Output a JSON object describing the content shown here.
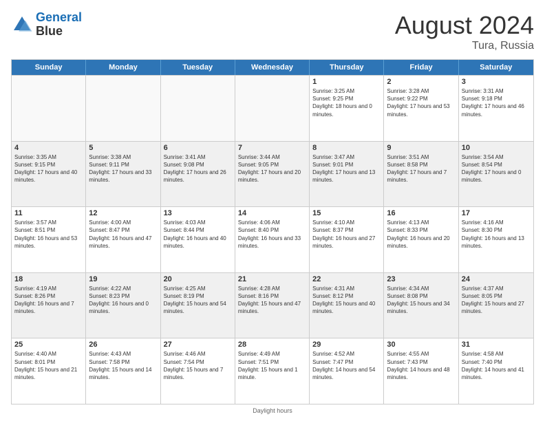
{
  "logo": {
    "line1": "General",
    "line2": "Blue"
  },
  "title": "August 2024",
  "location": "Tura, Russia",
  "days_of_week": [
    "Sunday",
    "Monday",
    "Tuesday",
    "Wednesday",
    "Thursday",
    "Friday",
    "Saturday"
  ],
  "footer_note": "Daylight hours",
  "weeks": [
    [
      {
        "day": "",
        "empty": true
      },
      {
        "day": "",
        "empty": true
      },
      {
        "day": "",
        "empty": true
      },
      {
        "day": "",
        "empty": true
      },
      {
        "day": "1",
        "sunrise": "Sunrise: 3:25 AM",
        "sunset": "Sunset: 9:25 PM",
        "daylight": "Daylight: 18 hours and 0 minutes."
      },
      {
        "day": "2",
        "sunrise": "Sunrise: 3:28 AM",
        "sunset": "Sunset: 9:22 PM",
        "daylight": "Daylight: 17 hours and 53 minutes."
      },
      {
        "day": "3",
        "sunrise": "Sunrise: 3:31 AM",
        "sunset": "Sunset: 9:18 PM",
        "daylight": "Daylight: 17 hours and 46 minutes."
      }
    ],
    [
      {
        "day": "4",
        "sunrise": "Sunrise: 3:35 AM",
        "sunset": "Sunset: 9:15 PM",
        "daylight": "Daylight: 17 hours and 40 minutes."
      },
      {
        "day": "5",
        "sunrise": "Sunrise: 3:38 AM",
        "sunset": "Sunset: 9:11 PM",
        "daylight": "Daylight: 17 hours and 33 minutes."
      },
      {
        "day": "6",
        "sunrise": "Sunrise: 3:41 AM",
        "sunset": "Sunset: 9:08 PM",
        "daylight": "Daylight: 17 hours and 26 minutes."
      },
      {
        "day": "7",
        "sunrise": "Sunrise: 3:44 AM",
        "sunset": "Sunset: 9:05 PM",
        "daylight": "Daylight: 17 hours and 20 minutes."
      },
      {
        "day": "8",
        "sunrise": "Sunrise: 3:47 AM",
        "sunset": "Sunset: 9:01 PM",
        "daylight": "Daylight: 17 hours and 13 minutes."
      },
      {
        "day": "9",
        "sunrise": "Sunrise: 3:51 AM",
        "sunset": "Sunset: 8:58 PM",
        "daylight": "Daylight: 17 hours and 7 minutes."
      },
      {
        "day": "10",
        "sunrise": "Sunrise: 3:54 AM",
        "sunset": "Sunset: 8:54 PM",
        "daylight": "Daylight: 17 hours and 0 minutes."
      }
    ],
    [
      {
        "day": "11",
        "sunrise": "Sunrise: 3:57 AM",
        "sunset": "Sunset: 8:51 PM",
        "daylight": "Daylight: 16 hours and 53 minutes."
      },
      {
        "day": "12",
        "sunrise": "Sunrise: 4:00 AM",
        "sunset": "Sunset: 8:47 PM",
        "daylight": "Daylight: 16 hours and 47 minutes."
      },
      {
        "day": "13",
        "sunrise": "Sunrise: 4:03 AM",
        "sunset": "Sunset: 8:44 PM",
        "daylight": "Daylight: 16 hours and 40 minutes."
      },
      {
        "day": "14",
        "sunrise": "Sunrise: 4:06 AM",
        "sunset": "Sunset: 8:40 PM",
        "daylight": "Daylight: 16 hours and 33 minutes."
      },
      {
        "day": "15",
        "sunrise": "Sunrise: 4:10 AM",
        "sunset": "Sunset: 8:37 PM",
        "daylight": "Daylight: 16 hours and 27 minutes."
      },
      {
        "day": "16",
        "sunrise": "Sunrise: 4:13 AM",
        "sunset": "Sunset: 8:33 PM",
        "daylight": "Daylight: 16 hours and 20 minutes."
      },
      {
        "day": "17",
        "sunrise": "Sunrise: 4:16 AM",
        "sunset": "Sunset: 8:30 PM",
        "daylight": "Daylight: 16 hours and 13 minutes."
      }
    ],
    [
      {
        "day": "18",
        "sunrise": "Sunrise: 4:19 AM",
        "sunset": "Sunset: 8:26 PM",
        "daylight": "Daylight: 16 hours and 7 minutes."
      },
      {
        "day": "19",
        "sunrise": "Sunrise: 4:22 AM",
        "sunset": "Sunset: 8:23 PM",
        "daylight": "Daylight: 16 hours and 0 minutes."
      },
      {
        "day": "20",
        "sunrise": "Sunrise: 4:25 AM",
        "sunset": "Sunset: 8:19 PM",
        "daylight": "Daylight: 15 hours and 54 minutes."
      },
      {
        "day": "21",
        "sunrise": "Sunrise: 4:28 AM",
        "sunset": "Sunset: 8:16 PM",
        "daylight": "Daylight: 15 hours and 47 minutes."
      },
      {
        "day": "22",
        "sunrise": "Sunrise: 4:31 AM",
        "sunset": "Sunset: 8:12 PM",
        "daylight": "Daylight: 15 hours and 40 minutes."
      },
      {
        "day": "23",
        "sunrise": "Sunrise: 4:34 AM",
        "sunset": "Sunset: 8:08 PM",
        "daylight": "Daylight: 15 hours and 34 minutes."
      },
      {
        "day": "24",
        "sunrise": "Sunrise: 4:37 AM",
        "sunset": "Sunset: 8:05 PM",
        "daylight": "Daylight: 15 hours and 27 minutes."
      }
    ],
    [
      {
        "day": "25",
        "sunrise": "Sunrise: 4:40 AM",
        "sunset": "Sunset: 8:01 PM",
        "daylight": "Daylight: 15 hours and 21 minutes."
      },
      {
        "day": "26",
        "sunrise": "Sunrise: 4:43 AM",
        "sunset": "Sunset: 7:58 PM",
        "daylight": "Daylight: 15 hours and 14 minutes."
      },
      {
        "day": "27",
        "sunrise": "Sunrise: 4:46 AM",
        "sunset": "Sunset: 7:54 PM",
        "daylight": "Daylight: 15 hours and 7 minutes."
      },
      {
        "day": "28",
        "sunrise": "Sunrise: 4:49 AM",
        "sunset": "Sunset: 7:51 PM",
        "daylight": "Daylight: 15 hours and 1 minute."
      },
      {
        "day": "29",
        "sunrise": "Sunrise: 4:52 AM",
        "sunset": "Sunset: 7:47 PM",
        "daylight": "Daylight: 14 hours and 54 minutes."
      },
      {
        "day": "30",
        "sunrise": "Sunrise: 4:55 AM",
        "sunset": "Sunset: 7:43 PM",
        "daylight": "Daylight: 14 hours and 48 minutes."
      },
      {
        "day": "31",
        "sunrise": "Sunrise: 4:58 AM",
        "sunset": "Sunset: 7:40 PM",
        "daylight": "Daylight: 14 hours and 41 minutes."
      }
    ]
  ]
}
